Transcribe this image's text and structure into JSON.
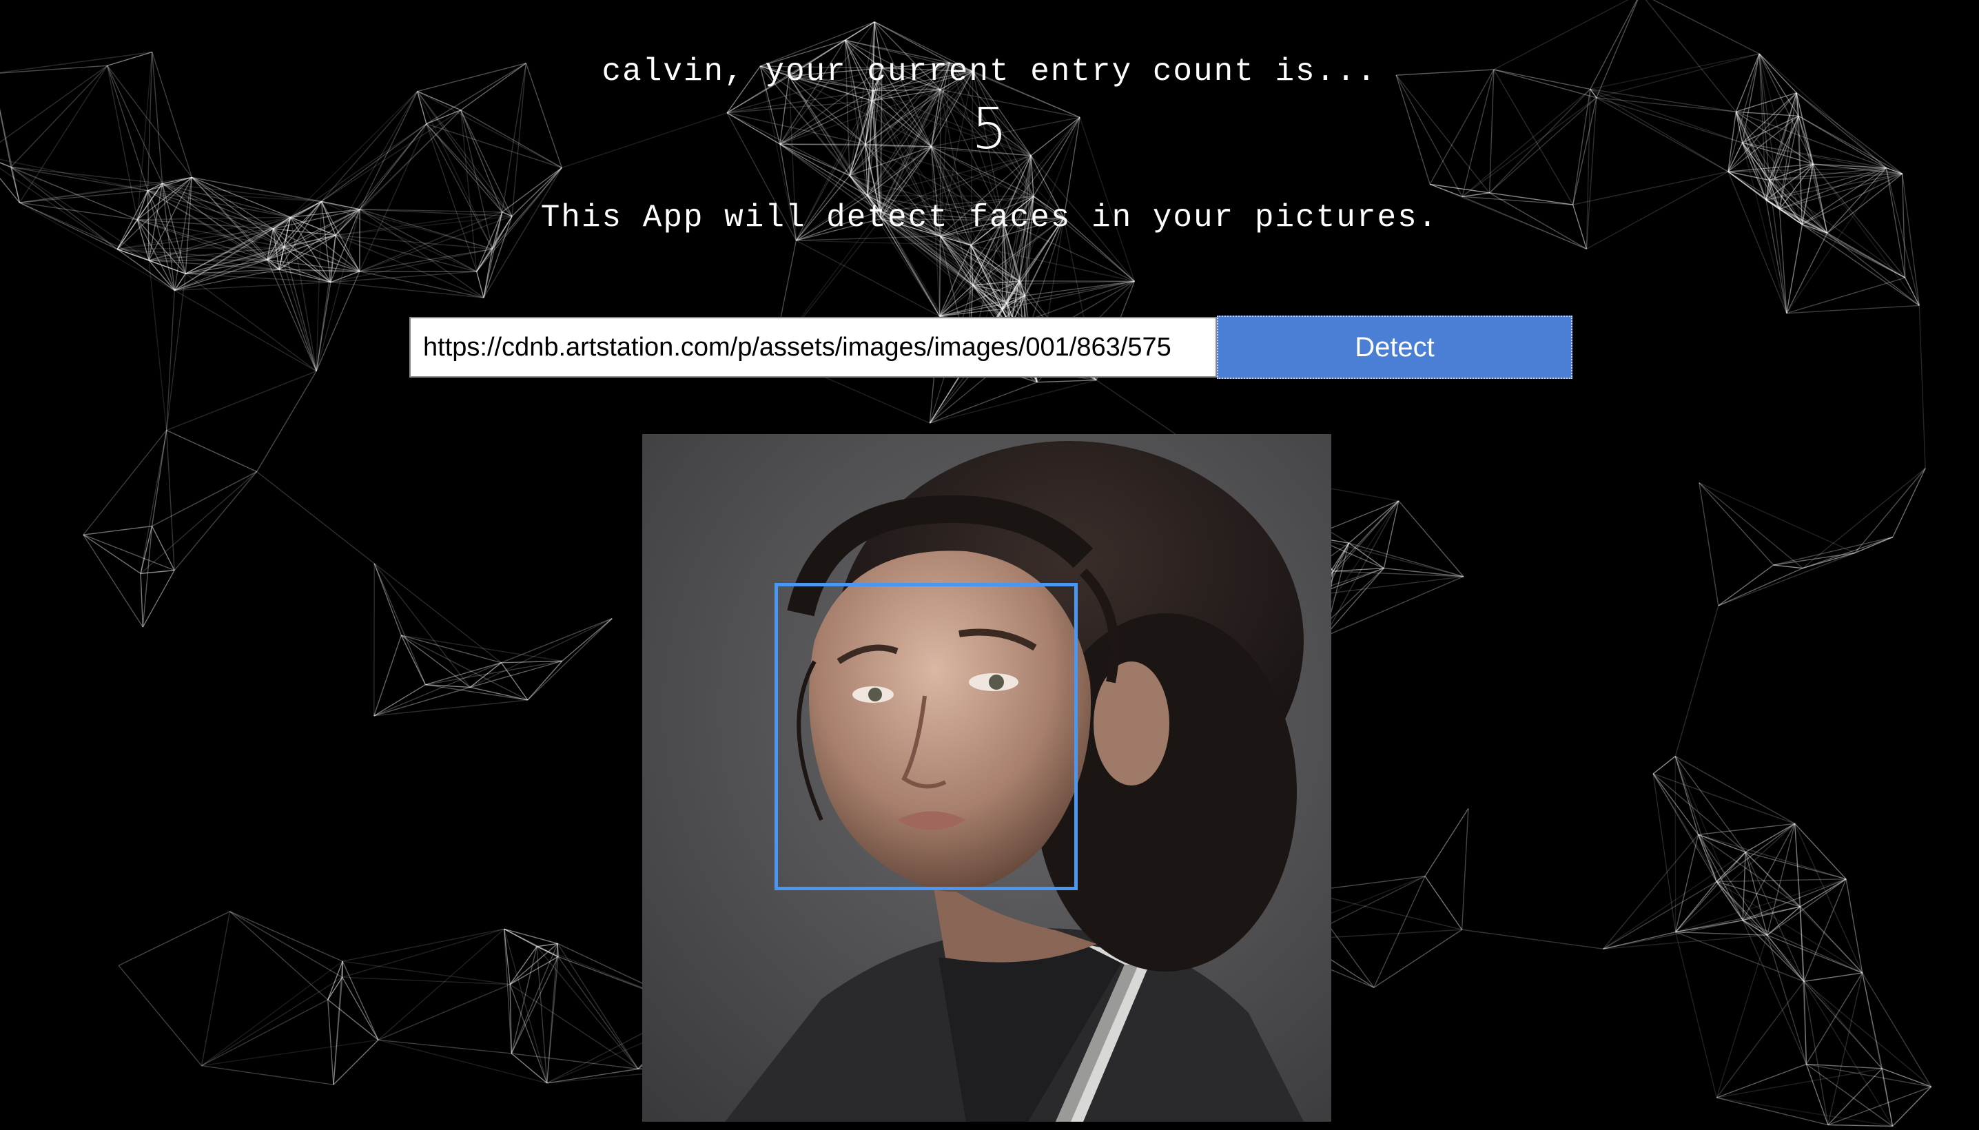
{
  "header": {
    "greeting": "calvin, your current entry count is...",
    "entry_count": "5"
  },
  "description": "This App will detect faces in your pictures.",
  "form": {
    "url_value": "https://cdnb.artstation.com/p/assets/images/images/001/863/575",
    "detect_label": "Detect"
  },
  "colors": {
    "background": "#000000",
    "button": "#4b7fd5",
    "face_box": "#4a96f0"
  },
  "image": {
    "subject": "portrait photo",
    "faces_detected": 1
  }
}
